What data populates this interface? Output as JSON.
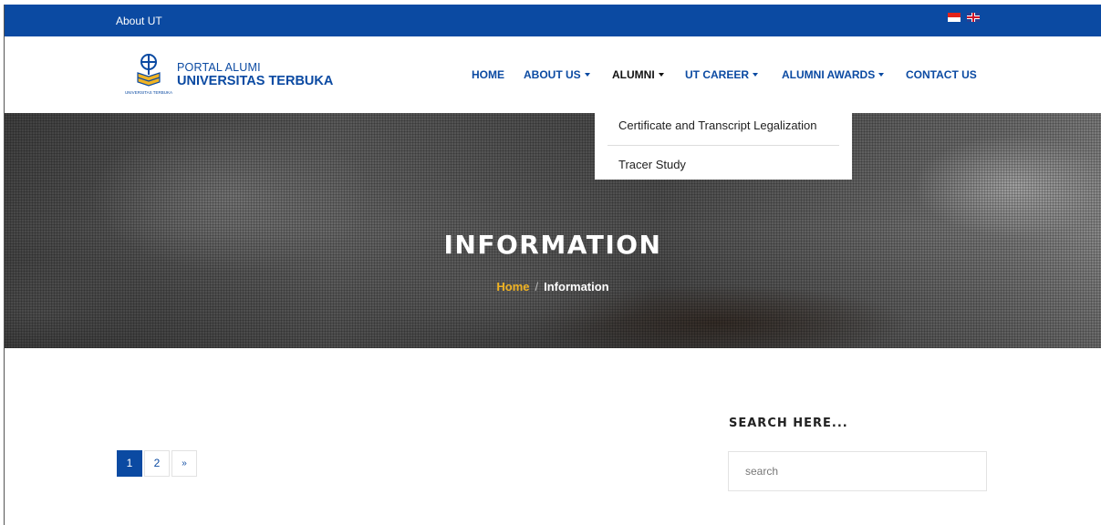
{
  "topbar": {
    "about_label": "About UT",
    "bg_color": "#0b4aa2"
  },
  "header": {
    "brand_line1": "PORTAL ALUMI",
    "brand_line2": "UNIVERSITAS TERBUKA",
    "logo_caption": "UNIVERSITAS TERBUKA"
  },
  "nav": {
    "home": "HOME",
    "about": "ABOUT US",
    "alumni": "ALUMNI",
    "career": "UT CAREER",
    "awards": "ALUMNI AWARDS",
    "contact": "CONTACT US"
  },
  "dropdown": {
    "items": [
      {
        "label": "Certificate and Transcript Legalization"
      },
      {
        "label": "Tracer Study"
      }
    ]
  },
  "hero": {
    "title": "INFORMATION",
    "breadcrumb_home": "Home",
    "breadcrumb_sep": "/",
    "breadcrumb_current": "Information"
  },
  "pagination": {
    "pages": [
      "1",
      "2"
    ],
    "next": "»",
    "active_page": "1"
  },
  "sidebar": {
    "title": "SEARCH HERE...",
    "search_placeholder": "search"
  },
  "colors": {
    "primary": "#0b4aa2",
    "accent": "#f0b323"
  }
}
